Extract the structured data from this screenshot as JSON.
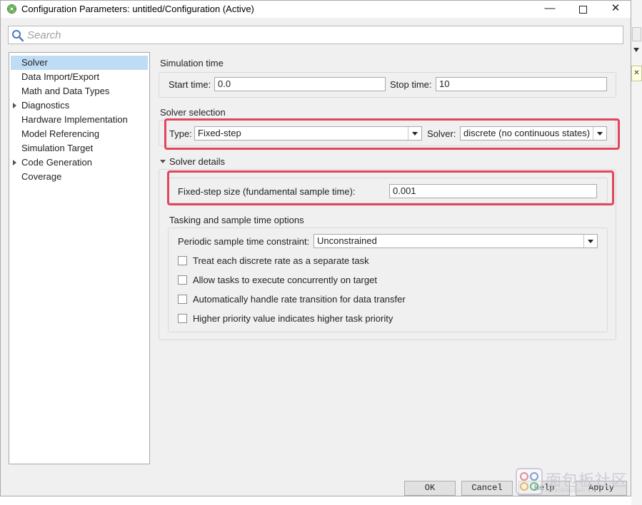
{
  "window": {
    "title": "Configuration Parameters: untitled/Configuration (Active)",
    "minimize_glyph": "—",
    "close_glyph": "✕"
  },
  "search": {
    "placeholder": "Search",
    "value": ""
  },
  "tree": {
    "items": [
      {
        "label": "Solver",
        "selected": true,
        "expandable": false
      },
      {
        "label": "Data Import/Export",
        "selected": false,
        "expandable": false
      },
      {
        "label": "Math and Data Types",
        "selected": false,
        "expandable": false
      },
      {
        "label": "Diagnostics",
        "selected": false,
        "expandable": true
      },
      {
        "label": "Hardware Implementation",
        "selected": false,
        "expandable": false
      },
      {
        "label": "Model Referencing",
        "selected": false,
        "expandable": false
      },
      {
        "label": "Simulation Target",
        "selected": false,
        "expandable": false
      },
      {
        "label": "Code Generation",
        "selected": false,
        "expandable": true
      },
      {
        "label": "Coverage",
        "selected": false,
        "expandable": false
      }
    ]
  },
  "simulation_time": {
    "title": "Simulation time",
    "start_label": "Start time:",
    "start_value": "0.0",
    "stop_label": "Stop time:",
    "stop_value": "10"
  },
  "solver_selection": {
    "title": "Solver selection",
    "type_label": "Type:",
    "type_value": "Fixed-step",
    "solver_label": "Solver:",
    "solver_value": "discrete (no continuous states)"
  },
  "solver_details": {
    "title": "Solver details",
    "step_label": "Fixed-step size (fundamental sample time):",
    "step_value": "0.001"
  },
  "tasking": {
    "title": "Tasking and sample time options",
    "constraint_label": "Periodic sample time constraint:",
    "constraint_value": "Unconstrained",
    "checkboxes": [
      {
        "label": "Treat each discrete rate as a separate task",
        "checked": false
      },
      {
        "label": "Allow tasks to execute concurrently on target",
        "checked": false
      },
      {
        "label": "Automatically handle rate transition for data transfer",
        "checked": false
      },
      {
        "label": "Higher priority value indicates higher task priority",
        "checked": false
      }
    ]
  },
  "buttons": {
    "ok": "OK",
    "cancel": "Cancel",
    "help": "Help",
    "apply": "Apply"
  },
  "watermark": {
    "text": "面包板社区",
    "sub": "mianbaoban.cn"
  },
  "colors": {
    "highlight": "#e0465c",
    "selection": "#bfdcf5",
    "panel": "#f0f0f0"
  }
}
